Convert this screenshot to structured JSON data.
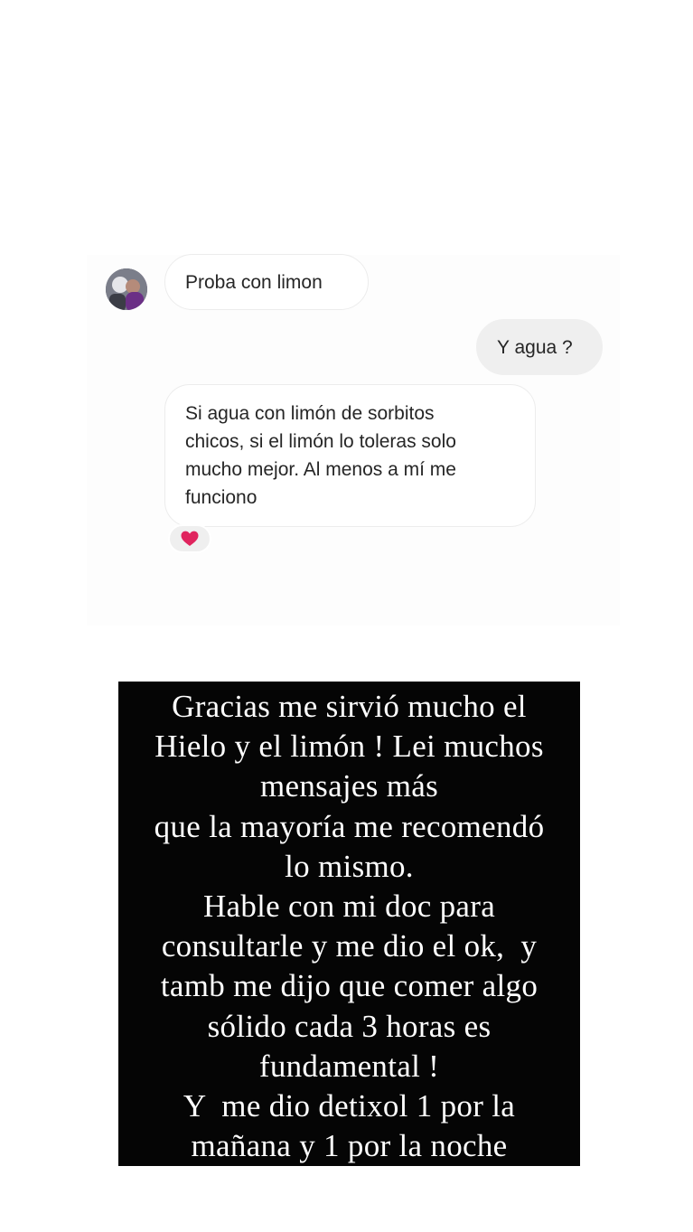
{
  "chat": {
    "avatar_icon": "user-avatar",
    "messages": [
      {
        "from": "other",
        "text": "Proba con limon"
      },
      {
        "from": "me",
        "text": "Y agua ?"
      },
      {
        "from": "other",
        "lines": [
          "Si agua con limón de sorbitos",
          "chicos, si el limón lo toleras solo",
          "mucho mejor. Al menos a mí me",
          "funciono"
        ]
      }
    ],
    "reaction": {
      "icon": "heart-icon",
      "color": "#e0245e"
    }
  },
  "note": {
    "lines": [
      "Gracias me sirvió mucho el",
      "Hielo y el limón ! Lei muchos",
      "mensajes más",
      "que la mayoría me recomendó",
      "lo mismo.",
      "Hable con mi doc para",
      "consultarle y me dio el ok,  y",
      "tamb me dijo que comer algo",
      "sólido cada 3 horas es",
      "fundamental !",
      "Y  me dio detixol 1 por la",
      "mañana y 1 por la noche"
    ]
  }
}
